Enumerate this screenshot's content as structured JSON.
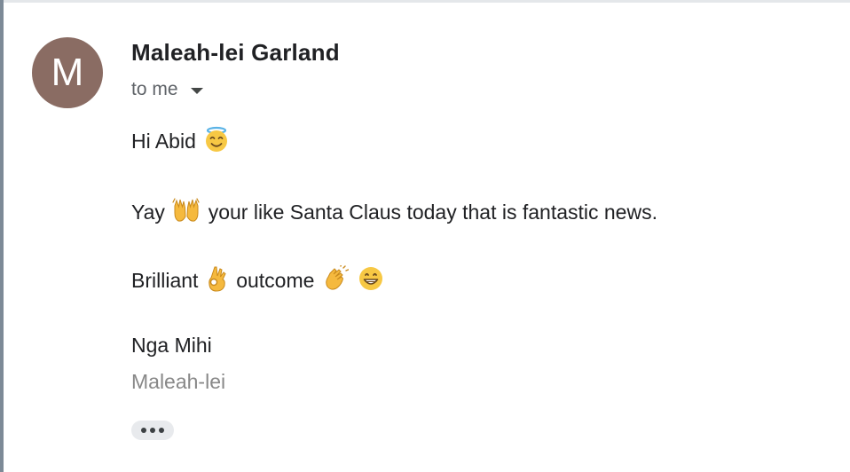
{
  "sender": {
    "avatar_initial": "M",
    "avatar_color": "#8a6c63",
    "name": "Maleah-lei Garland",
    "recipient_label": "to me"
  },
  "message": {
    "greeting": "Hi Abid",
    "greeting_emoji": "smiling-face-with-halo",
    "line2_part1": "Yay",
    "line2_emoji": "raising-hands",
    "line2_part2": "your like Santa Claus today that is fantastic news.",
    "line3_part1": "Brilliant",
    "line3_emoji1": "ok-hand",
    "line3_part2": "outcome",
    "line3_emoji2": "clapping-hands",
    "line3_emoji3": "grinning-face",
    "signoff": "Nga Mihi",
    "signature": "Maleah-lei"
  },
  "more_button": {
    "icon": "ellipsis-icon"
  }
}
